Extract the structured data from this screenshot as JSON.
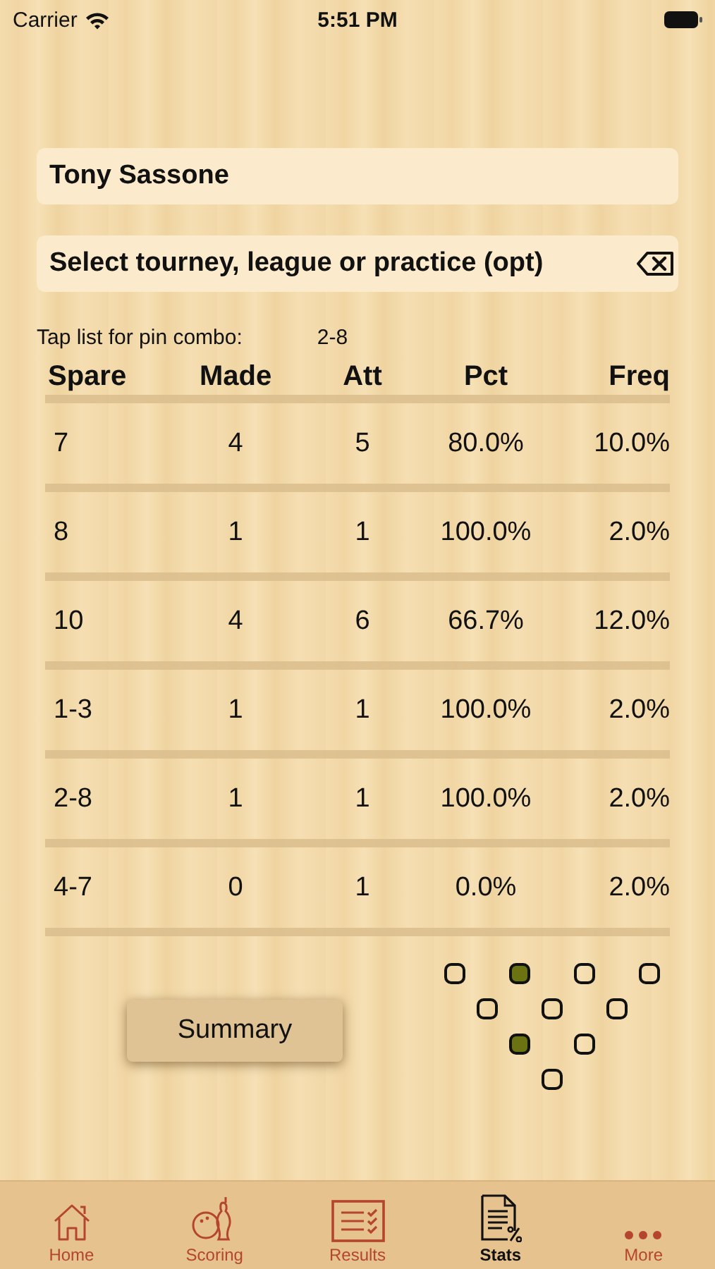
{
  "status_bar": {
    "carrier": "Carrier",
    "time": "5:51 PM"
  },
  "bowler_field": {
    "value": "Tony Sassone"
  },
  "event_field": {
    "value": "Select tourney, league or practice (opt)"
  },
  "combo_label": "Tap list for pin combo:",
  "combo_value": "2-8",
  "table": {
    "columns": [
      "Spare",
      "Made",
      "Att",
      "Pct",
      "Freq"
    ],
    "rows": [
      {
        "cells": [
          "7",
          "4",
          "5",
          "80.0%",
          "10.0%"
        ]
      },
      {
        "cells": [
          "8",
          "1",
          "1",
          "100.0%",
          "2.0%"
        ]
      },
      {
        "cells": [
          "10",
          "4",
          "6",
          "66.7%",
          "12.0%"
        ]
      },
      {
        "cells": [
          "1-3",
          "1",
          "1",
          "100.0%",
          "2.0%"
        ]
      },
      {
        "cells": [
          "2-8",
          "1",
          "1",
          "100.0%",
          "2.0%"
        ]
      },
      {
        "cells": [
          "4-7",
          "0",
          "1",
          "0.0%",
          "2.0%"
        ]
      }
    ]
  },
  "summary_button": "Summary",
  "pins": [
    [
      {
        "filled": false
      },
      {
        "filled": true
      },
      {
        "filled": false
      },
      {
        "filled": false
      }
    ],
    [
      {
        "filled": false
      },
      {
        "filled": false
      },
      {
        "filled": false
      }
    ],
    [
      {
        "filled": true
      },
      {
        "filled": false
      }
    ],
    [
      {
        "filled": false
      }
    ]
  ],
  "tabs": [
    {
      "label": "Home",
      "kind": "home",
      "selected": false
    },
    {
      "label": "Scoring",
      "kind": "scoring",
      "selected": false
    },
    {
      "label": "Results",
      "kind": "results",
      "selected": false
    },
    {
      "label": "Stats",
      "kind": "stats",
      "selected": true
    },
    {
      "label": "More",
      "kind": "more",
      "selected": false
    }
  ]
}
